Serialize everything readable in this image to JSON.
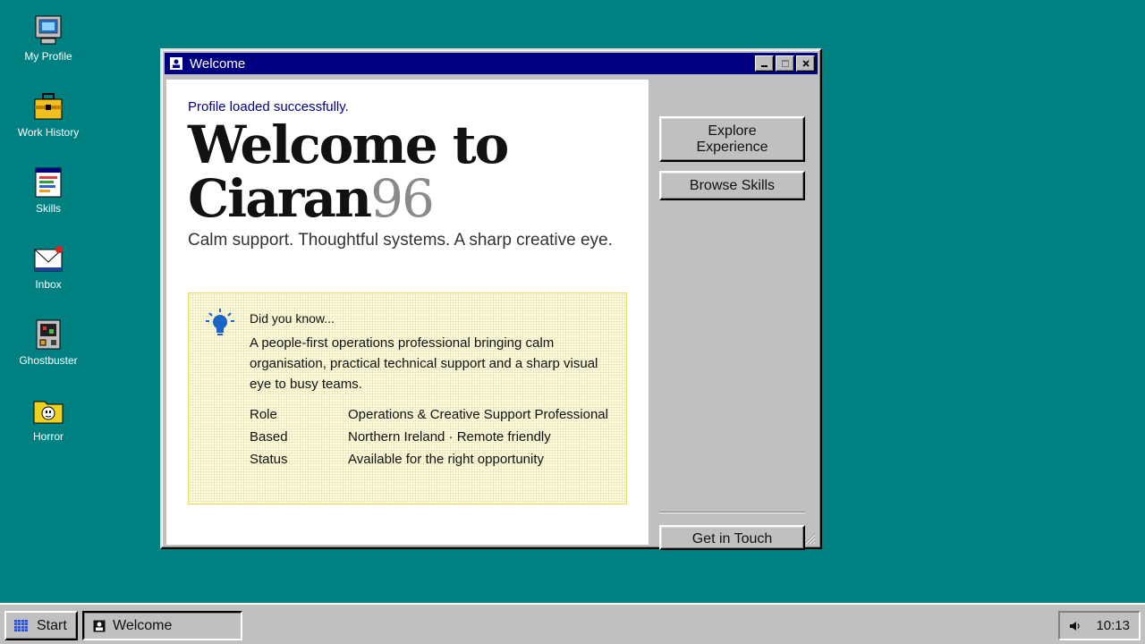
{
  "desktop": {
    "icons": [
      {
        "label": "My Profile",
        "icon": "computer-icon"
      },
      {
        "label": "Work History",
        "icon": "briefcase-icon"
      },
      {
        "label": "Skills",
        "icon": "skills-document-icon"
      },
      {
        "label": "Inbox",
        "icon": "mail-icon"
      },
      {
        "label": "Ghostbuster",
        "icon": "game-machine-icon"
      },
      {
        "label": "Horror",
        "icon": "ghost-folder-icon"
      }
    ]
  },
  "window": {
    "title": "Welcome",
    "status": "Profile loaded successfully.",
    "headline_line1": "Welcome to",
    "headline_name": "Ciaran",
    "headline_num": "96",
    "tagline": "Calm support. Thoughtful systems. A sharp creative eye.",
    "tip": {
      "heading": "Did you know...",
      "body": "A people-first operations professional bringing calm organisation, practical technical support and a sharp visual eye to busy teams.",
      "facts": [
        {
          "label": "Role",
          "value": "Operations & Creative Support Professional"
        },
        {
          "label": "Based",
          "value": "Northern Ireland · Remote friendly"
        },
        {
          "label": "Status",
          "value": "Available for the right opportunity"
        }
      ]
    },
    "buttons": {
      "explore_line1": "Explore",
      "explore_line2": "Experience",
      "browse": "Browse Skills",
      "contact": "Get in Touch"
    }
  },
  "taskbar": {
    "start_label": "Start",
    "task_label": "Welcome",
    "clock": "10:13"
  },
  "colors": {
    "desktop": "#008080",
    "titlebar": "#000080",
    "chrome": "#c0c0c0",
    "tip_bg": "#fdfbe0"
  }
}
